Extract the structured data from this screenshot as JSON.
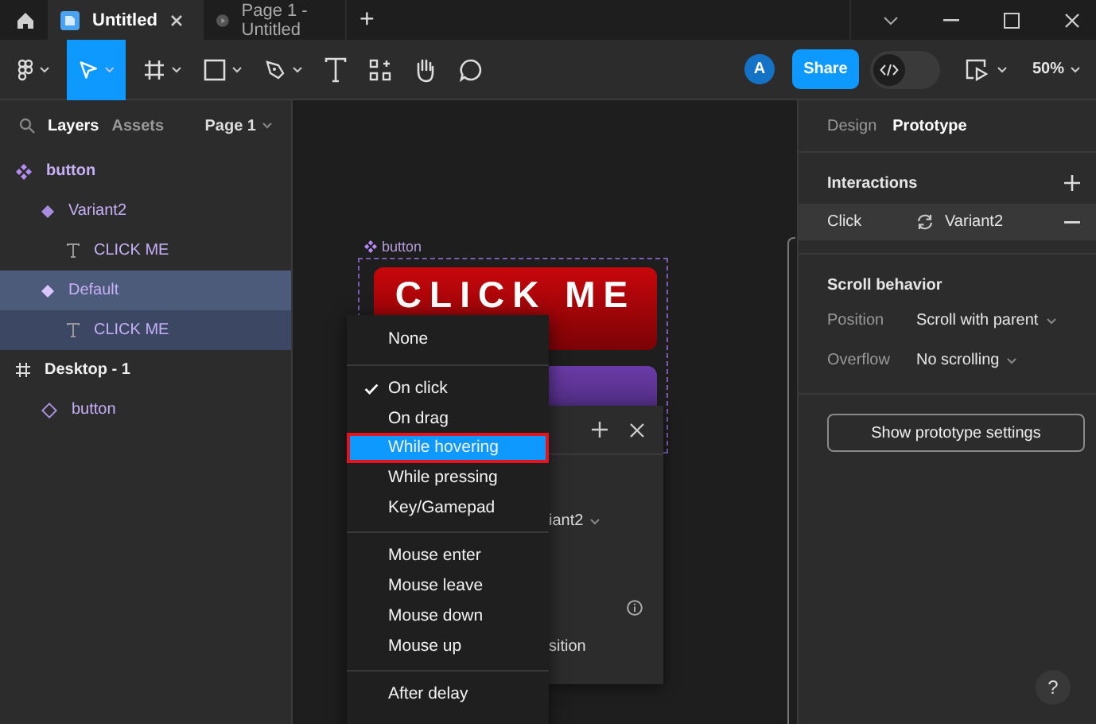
{
  "titlebar": {
    "tabs": [
      {
        "label": "Untitled",
        "selected": true,
        "kind": "file"
      },
      {
        "label": "Page 1 - Untitled",
        "selected": false,
        "kind": "prototype"
      }
    ],
    "new_tab": "+"
  },
  "toolbar": {
    "tools": [
      {
        "kind": "main-menu",
        "selected": false,
        "dropdown": true
      },
      {
        "kind": "move",
        "selected": true,
        "dropdown": true
      },
      {
        "kind": "frame",
        "selected": false,
        "dropdown": true
      },
      {
        "kind": "shape",
        "selected": false,
        "dropdown": true
      },
      {
        "kind": "pen",
        "selected": false,
        "dropdown": true
      },
      {
        "kind": "text",
        "selected": false,
        "dropdown": false
      },
      {
        "kind": "resources",
        "selected": false,
        "dropdown": false
      },
      {
        "kind": "hand",
        "selected": false,
        "dropdown": false
      },
      {
        "kind": "comment",
        "selected": false,
        "dropdown": false
      }
    ],
    "avatar": "A",
    "share": "Share",
    "dev_mode": false,
    "zoom": "50%"
  },
  "layers_panel": {
    "tabs": [
      {
        "label": "Layers",
        "selected": true
      },
      {
        "label": "Assets",
        "selected": false
      }
    ],
    "page": "Page 1",
    "layers": [
      {
        "name": "button",
        "kind": "component-set",
        "selected": false,
        "children": [
          {
            "name": "Variant2",
            "kind": "variant",
            "selected": false,
            "children": [
              {
                "name": "CLICK ME",
                "kind": "text",
                "selected": false
              }
            ]
          },
          {
            "name": "Default",
            "kind": "variant",
            "selected": true,
            "children": [
              {
                "name": "CLICK ME",
                "kind": "text",
                "selected": false
              }
            ]
          }
        ]
      },
      {
        "name": "Desktop - 1",
        "kind": "frame",
        "selected": false,
        "children": [
          {
            "name": "button",
            "kind": "instance",
            "selected": false
          }
        ]
      }
    ]
  },
  "canvas": {
    "frame_label": "button",
    "variants": [
      {
        "label": "CLICK ME",
        "color": "#c8070b"
      },
      {
        "color": "#6a3aa6"
      }
    ]
  },
  "popup": {
    "value_fragment": "iant2",
    "text_fragment": "sition"
  },
  "trigger_menu": {
    "groups": [
      [
        {
          "label": "None",
          "checked": false,
          "selected": false,
          "outlined": false
        }
      ],
      [
        {
          "label": "On click",
          "checked": true,
          "selected": false,
          "outlined": false
        },
        {
          "label": "On drag",
          "checked": false,
          "selected": false,
          "outlined": false
        },
        {
          "label": "While hovering",
          "checked": false,
          "selected": true,
          "outlined": true
        },
        {
          "label": "While pressing",
          "checked": false,
          "selected": false,
          "outlined": false
        },
        {
          "label": "Key/Gamepad",
          "checked": false,
          "selected": false,
          "outlined": false
        }
      ],
      [
        {
          "label": "Mouse enter",
          "checked": false,
          "selected": false,
          "outlined": false
        },
        {
          "label": "Mouse leave",
          "checked": false,
          "selected": false,
          "outlined": false
        },
        {
          "label": "Mouse down",
          "checked": false,
          "selected": false,
          "outlined": false
        },
        {
          "label": "Mouse up",
          "checked": false,
          "selected": false,
          "outlined": false
        }
      ],
      [
        {
          "label": "After delay",
          "checked": false,
          "selected": false,
          "outlined": false
        }
      ]
    ]
  },
  "right_panel": {
    "tabs": [
      {
        "label": "Design",
        "selected": false
      },
      {
        "label": "Prototype",
        "selected": true
      }
    ],
    "interactions": {
      "title": "Interactions",
      "items": [
        {
          "trigger": "Click",
          "target": "Variant2"
        }
      ]
    },
    "scroll_behavior": {
      "title": "Scroll behavior",
      "fields": [
        {
          "label": "Position",
          "value": "Scroll with parent"
        },
        {
          "label": "Overflow",
          "value": "No scrolling"
        }
      ]
    },
    "settings_button": "Show prototype settings"
  },
  "help": "?"
}
